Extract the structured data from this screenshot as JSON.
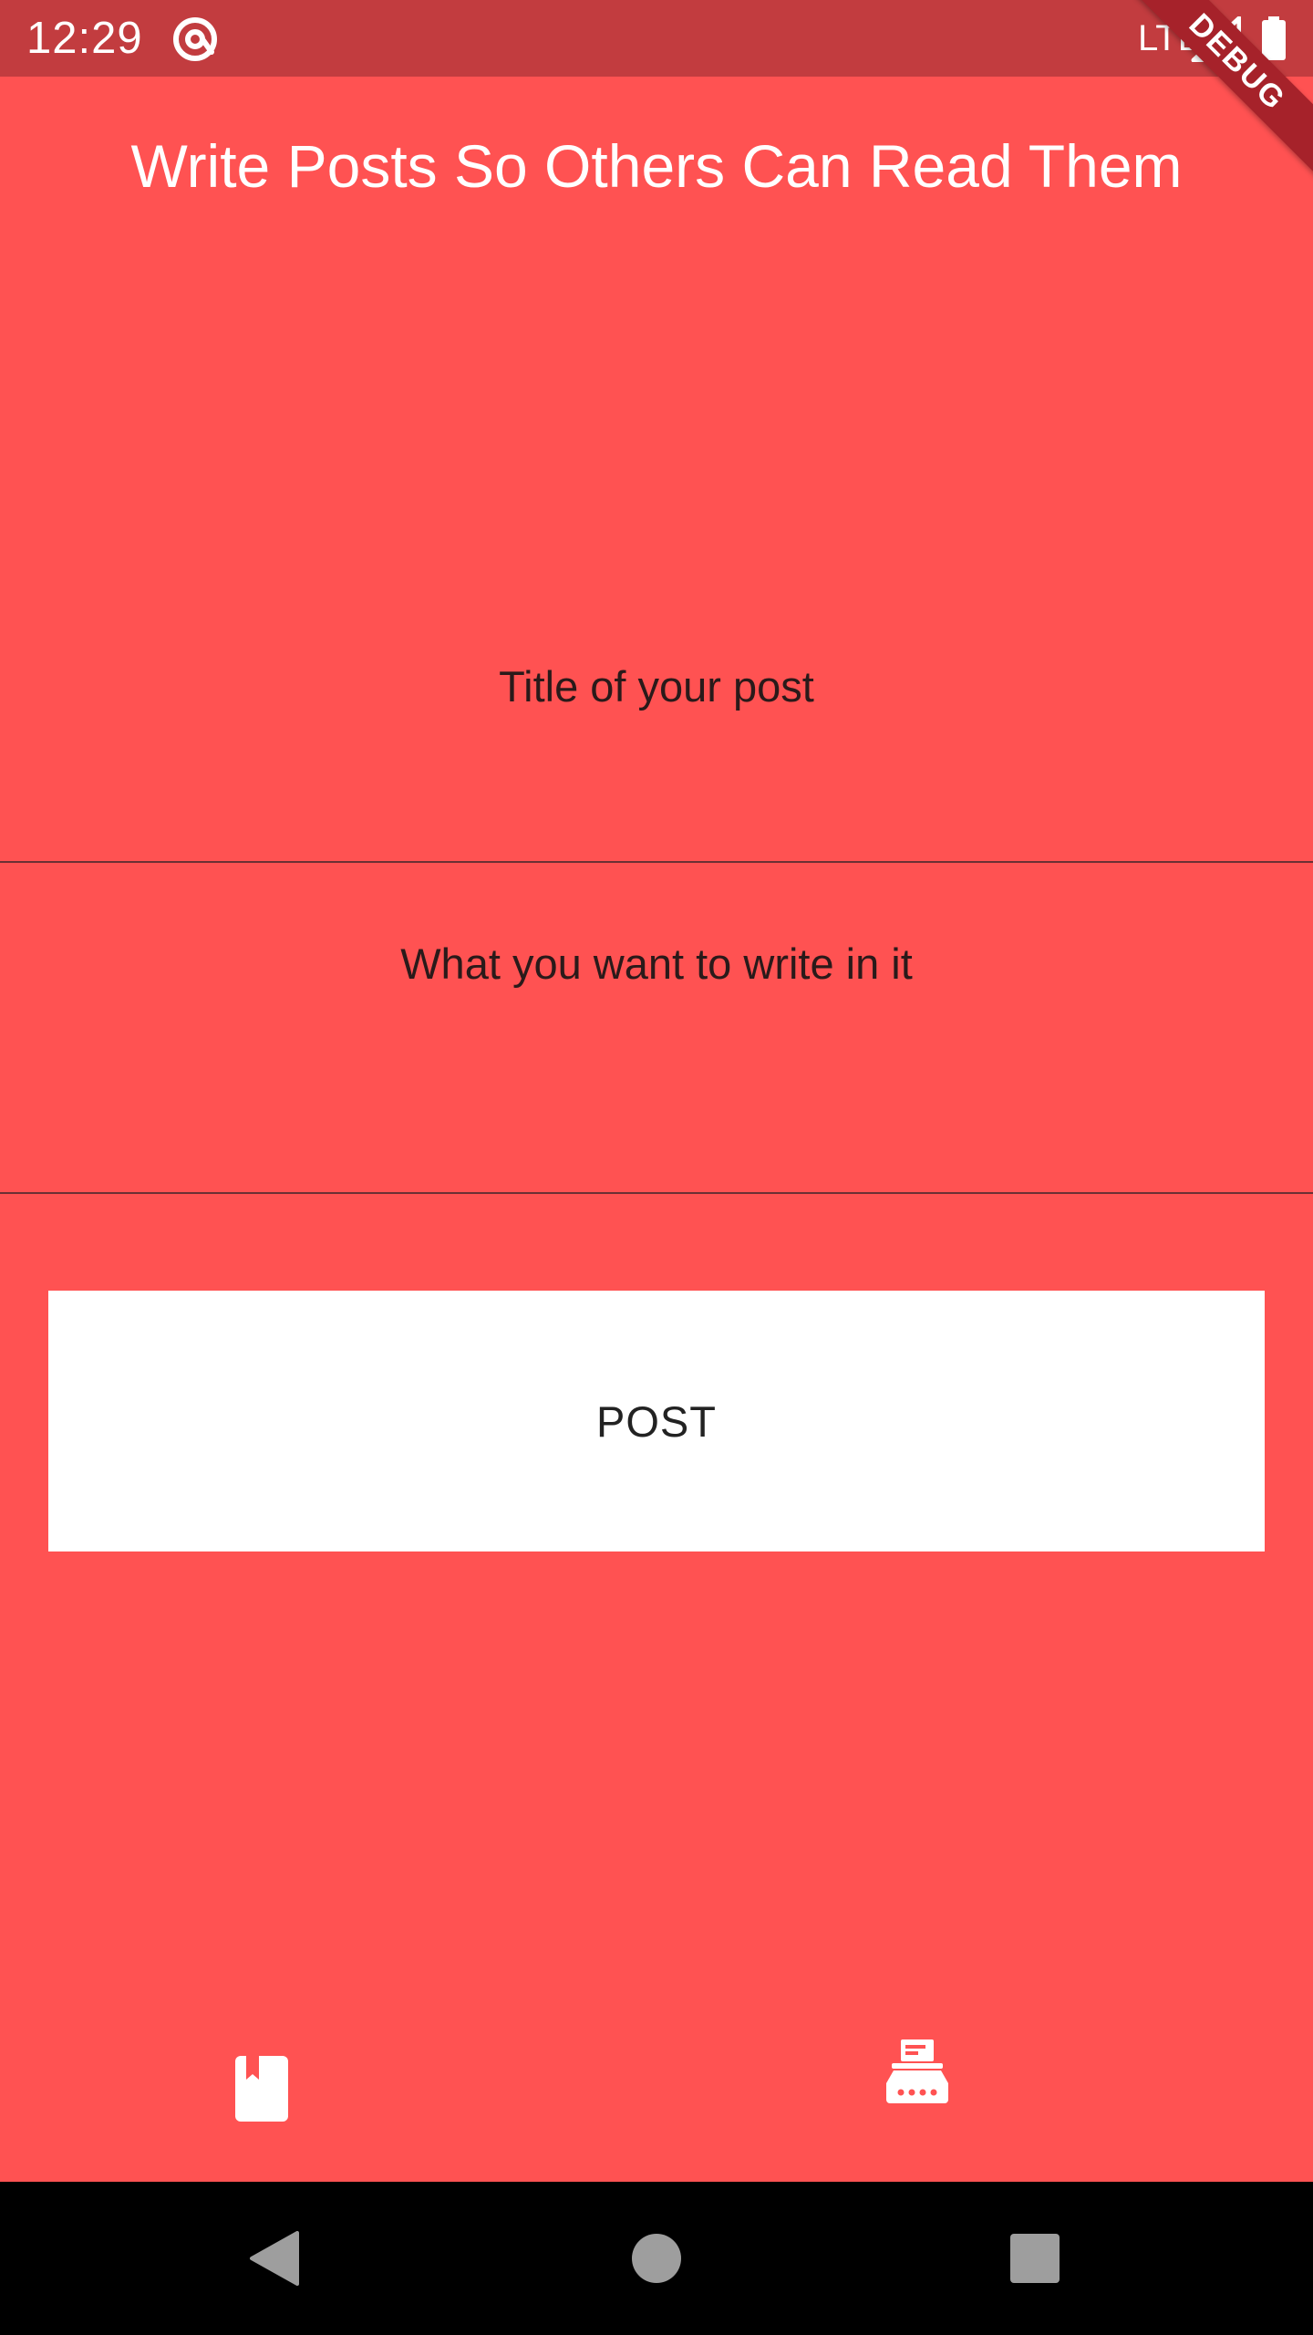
{
  "status_bar": {
    "time": "12:29",
    "network": "LTE",
    "app_icon": "at-sign-icon",
    "signal_icon": "signal-icon",
    "battery_icon": "battery-icon"
  },
  "debug_banner": "DEBUG",
  "app_bar": {
    "title": "Write Posts So Others Can Read Them"
  },
  "form": {
    "title_placeholder": "Title of your post",
    "body_placeholder": "What you want to write in it",
    "post_label": "POST"
  },
  "bottom_nav": {
    "items": [
      {
        "icon": "book-icon",
        "active": true
      },
      {
        "icon": "typewriter-icon",
        "active": false
      }
    ]
  },
  "system_nav": {
    "back_icon": "back-triangle-icon",
    "home_icon": "home-circle-icon",
    "recents_icon": "recents-square-icon"
  },
  "colors": {
    "background": "#ff5252",
    "status_bar": "#c23c3f",
    "divider": "#6b3034",
    "button": "#ffffff",
    "debug_banner": "#a6222a",
    "system_nav": "#000000"
  }
}
